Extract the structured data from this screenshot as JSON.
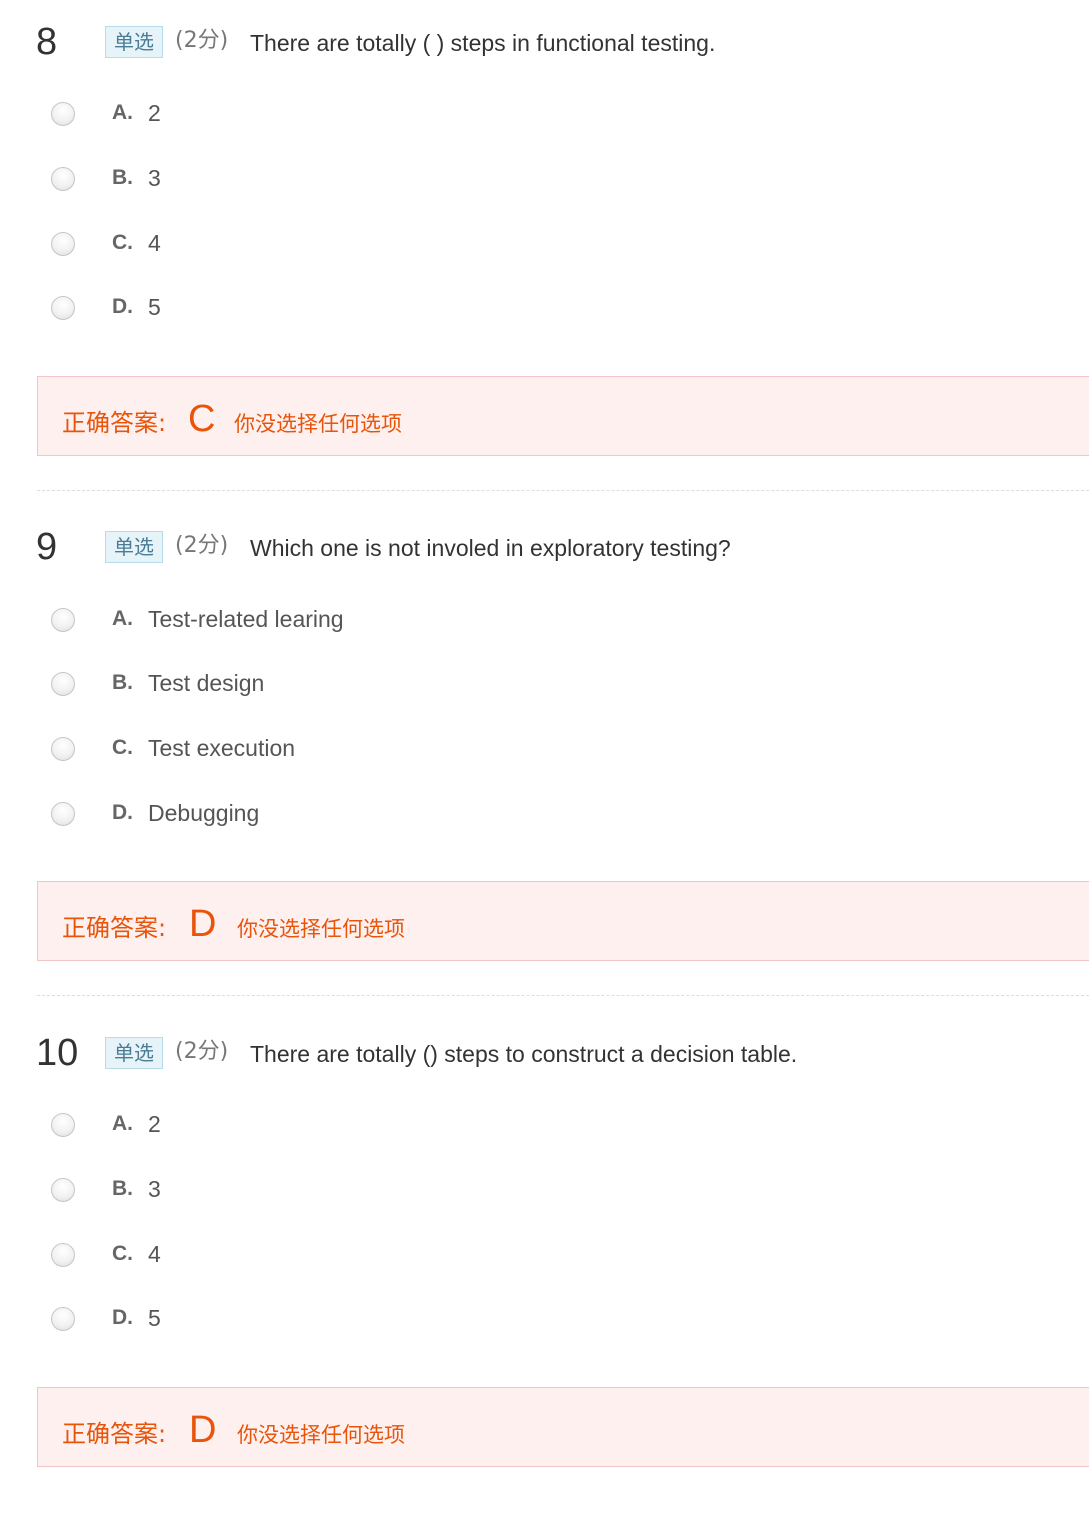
{
  "questions": [
    {
      "number": "8",
      "type": "单选",
      "score": "(2分)",
      "text": "There are totally ( ) steps in functional testing.",
      "options": [
        {
          "letter": "A.",
          "text": "2"
        },
        {
          "letter": "B.",
          "text": "3"
        },
        {
          "letter": "C.",
          "text": "4"
        },
        {
          "letter": "D.",
          "text": "5"
        }
      ],
      "answer_label": "正确答案:",
      "answer_value": "C",
      "answer_note": "你没选择任何选项"
    },
    {
      "number": "9",
      "type": "单选",
      "score": "(2分)",
      "text": "Which one is not involed in exploratory testing?",
      "options": [
        {
          "letter": "A.",
          "text": "Test-related learing"
        },
        {
          "letter": "B.",
          "text": "Test design"
        },
        {
          "letter": "C.",
          "text": "Test execution"
        },
        {
          "letter": "D.",
          "text": "Debugging"
        }
      ],
      "answer_label": "正确答案:",
      "answer_value": "D",
      "answer_note": "你没选择任何选项"
    },
    {
      "number": "10",
      "type": "单选",
      "score": "(2分)",
      "text": "There are totally () steps to construct a decision table.",
      "options": [
        {
          "letter": "A.",
          "text": "2"
        },
        {
          "letter": "B.",
          "text": "3"
        },
        {
          "letter": "C.",
          "text": "4"
        },
        {
          "letter": "D.",
          "text": "5"
        }
      ],
      "answer_label": "正确答案:",
      "answer_value": "D",
      "answer_note": "你没选择任何选项"
    }
  ],
  "colors": {
    "answer_accent": "#e8540a",
    "answer_background": "#fff0f0",
    "type_badge_background": "#e6f4fa"
  }
}
